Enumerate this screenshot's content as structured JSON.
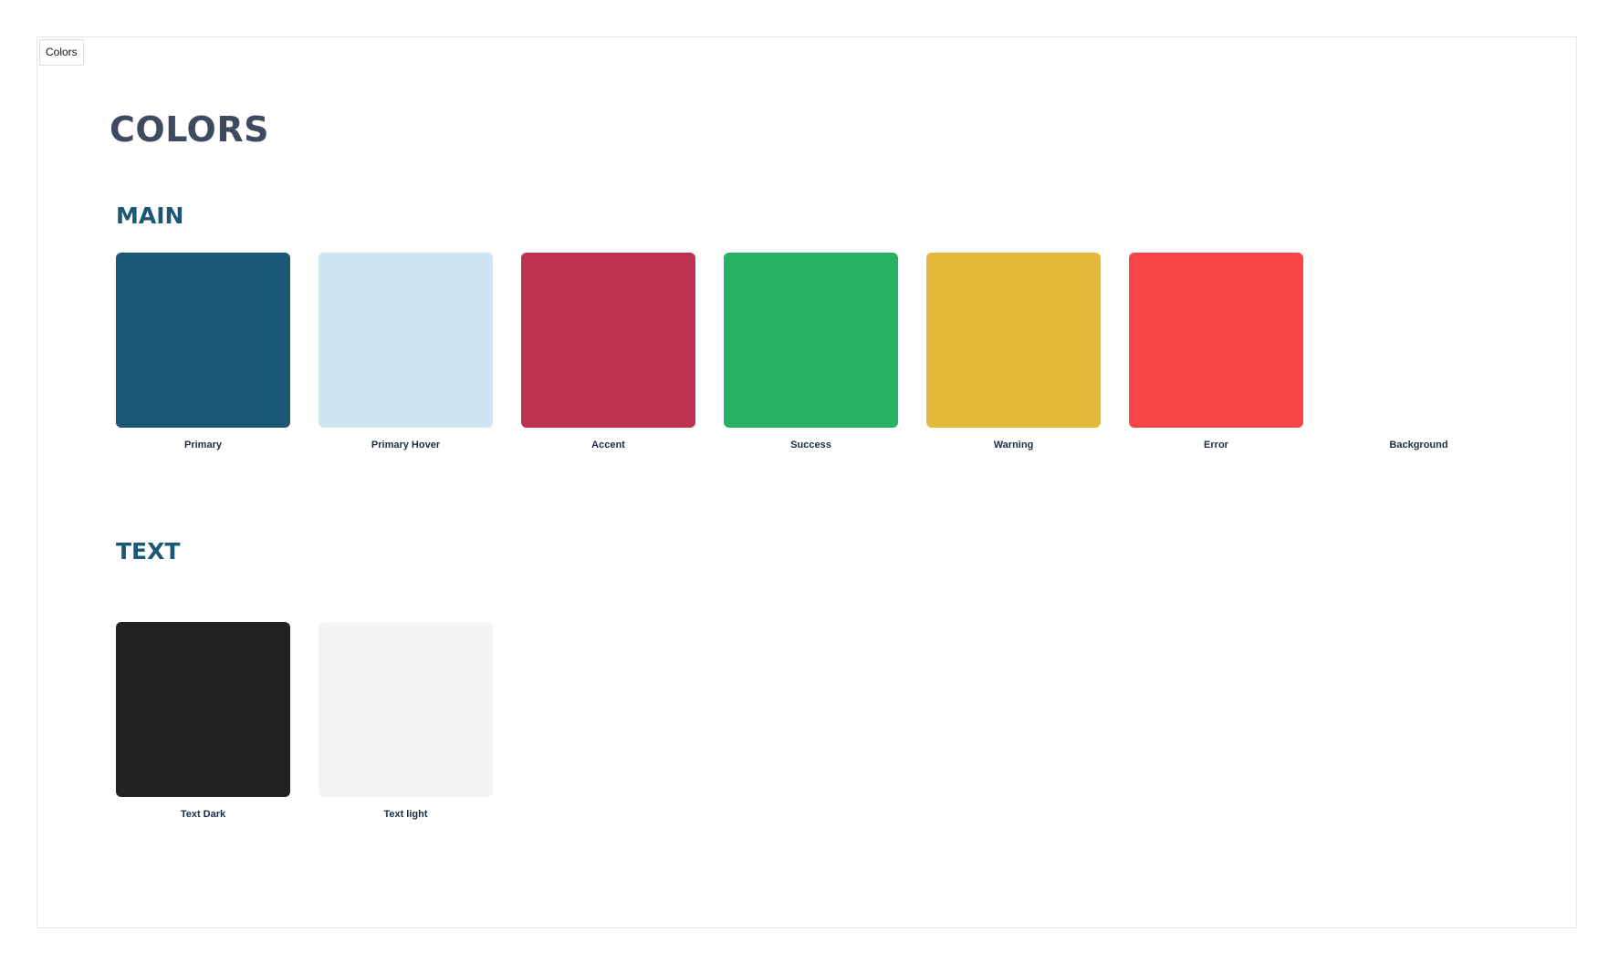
{
  "frame_tab": {
    "label": "Colors"
  },
  "page": {
    "title": "COLORS"
  },
  "sections": {
    "main": {
      "title": "MAIN",
      "swatches": [
        {
          "label": "Primary",
          "color": "#1b5876"
        },
        {
          "label": "Primary Hover",
          "color": "#cfe6f2"
        },
        {
          "label": "Accent",
          "color": "#bc3250"
        },
        {
          "label": "Success",
          "color": "#28b063"
        },
        {
          "label": "Warning",
          "color": "#e2b93b"
        },
        {
          "label": "Error",
          "color": "#f84445"
        },
        {
          "label": "Background",
          "color": "#ffffff"
        }
      ]
    },
    "text": {
      "title": "TEXT",
      "swatches": [
        {
          "label": "Text Dark",
          "color": "#222222"
        },
        {
          "label": "Text light",
          "color": "#f4f4f4"
        }
      ]
    }
  }
}
